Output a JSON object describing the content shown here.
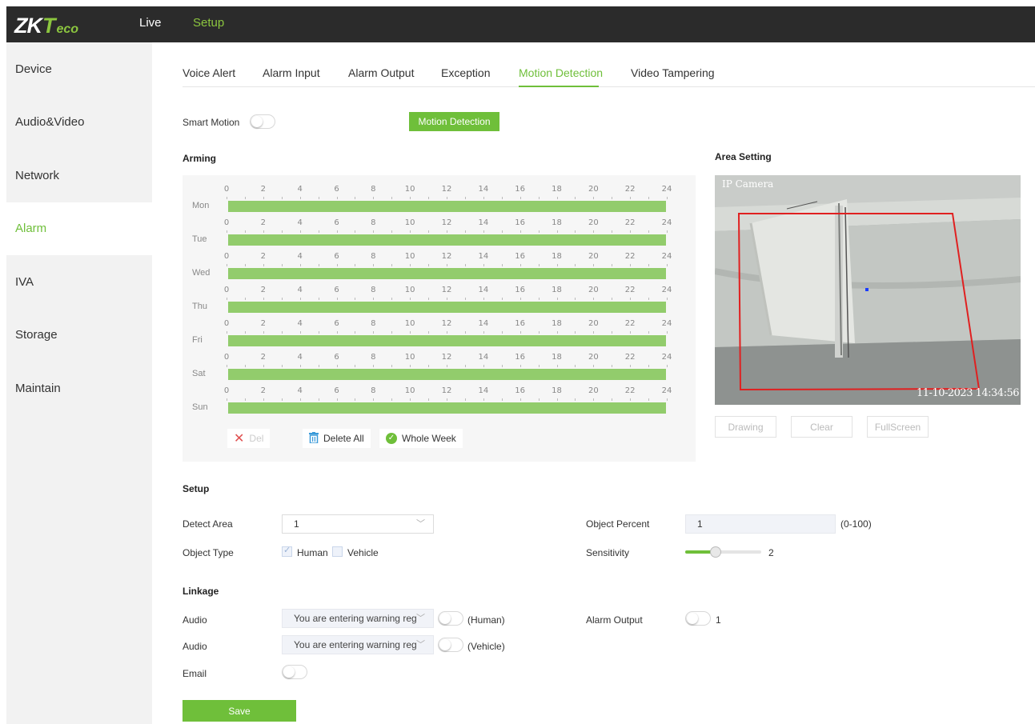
{
  "logo": {
    "zk": "ZK",
    "t": "T",
    "eco": "eco"
  },
  "topnav": [
    {
      "label": "Live"
    },
    {
      "label": "Setup"
    }
  ],
  "sidebar": {
    "items": [
      {
        "label": "Device"
      },
      {
        "label": "Audio&Video"
      },
      {
        "label": "Network"
      },
      {
        "label": "Alarm"
      },
      {
        "label": "IVA"
      },
      {
        "label": "Storage"
      },
      {
        "label": "Maintain"
      }
    ],
    "active_index": 3
  },
  "tabs": [
    {
      "label": "Voice Alert"
    },
    {
      "label": "Alarm Input"
    },
    {
      "label": "Alarm Output"
    },
    {
      "label": "Exception"
    },
    {
      "label": "Motion Detection"
    },
    {
      "label": "Video Tampering"
    }
  ],
  "smart_motion": {
    "label": "Smart Motion",
    "on": false
  },
  "motion_detection_button": "Motion Detection",
  "arming": {
    "title": "Arming",
    "days": [
      "Mon",
      "Tue",
      "Wed",
      "Thu",
      "Fri",
      "Sat",
      "Sun"
    ],
    "hour_ticks": [
      "0",
      "2",
      "4",
      "6",
      "8",
      "10",
      "12",
      "14",
      "16",
      "18",
      "20",
      "22",
      "24"
    ],
    "schedule_coverage": "0-24 all days",
    "buttons": {
      "del": "Del",
      "delete_all": "Delete All",
      "whole_week": "Whole Week"
    }
  },
  "area_setting": {
    "title": "Area Setting",
    "camera_label": "IP Camera",
    "timestamp": "11-10-2023 14:34:56",
    "buttons": {
      "drawing": "Drawing",
      "clear": "Clear",
      "fullscreen": "FullScreen"
    }
  },
  "setup": {
    "title": "Setup",
    "detect_area": {
      "label": "Detect Area",
      "value": "1"
    },
    "object_type": {
      "label": "Object Type",
      "human": "Human",
      "human_checked": true,
      "vehicle": "Vehicle",
      "vehicle_checked": false
    },
    "object_percent": {
      "label": "Object Percent",
      "value": "1",
      "range": "(0-100)"
    },
    "sensitivity": {
      "label": "Sensitivity",
      "value": "2",
      "level_fraction": 0.4
    }
  },
  "linkage": {
    "title": "Linkage",
    "audio_human": {
      "label": "Audio",
      "value": "You are entering warning reg",
      "suffix": "(Human)",
      "on": false
    },
    "audio_vehicle": {
      "label": "Audio",
      "value": "You are entering warning reg",
      "suffix": "(Vehicle)",
      "on": false
    },
    "email": {
      "label": "Email",
      "on": false
    },
    "alarm_output": {
      "label": "Alarm Output",
      "value": "1",
      "on": false
    }
  },
  "save_label": "Save",
  "colors": {
    "accent": "#6fbf3a",
    "bar": "#92cc6c",
    "topbar": "#2b2b2b",
    "area_outline": "#e02020"
  }
}
